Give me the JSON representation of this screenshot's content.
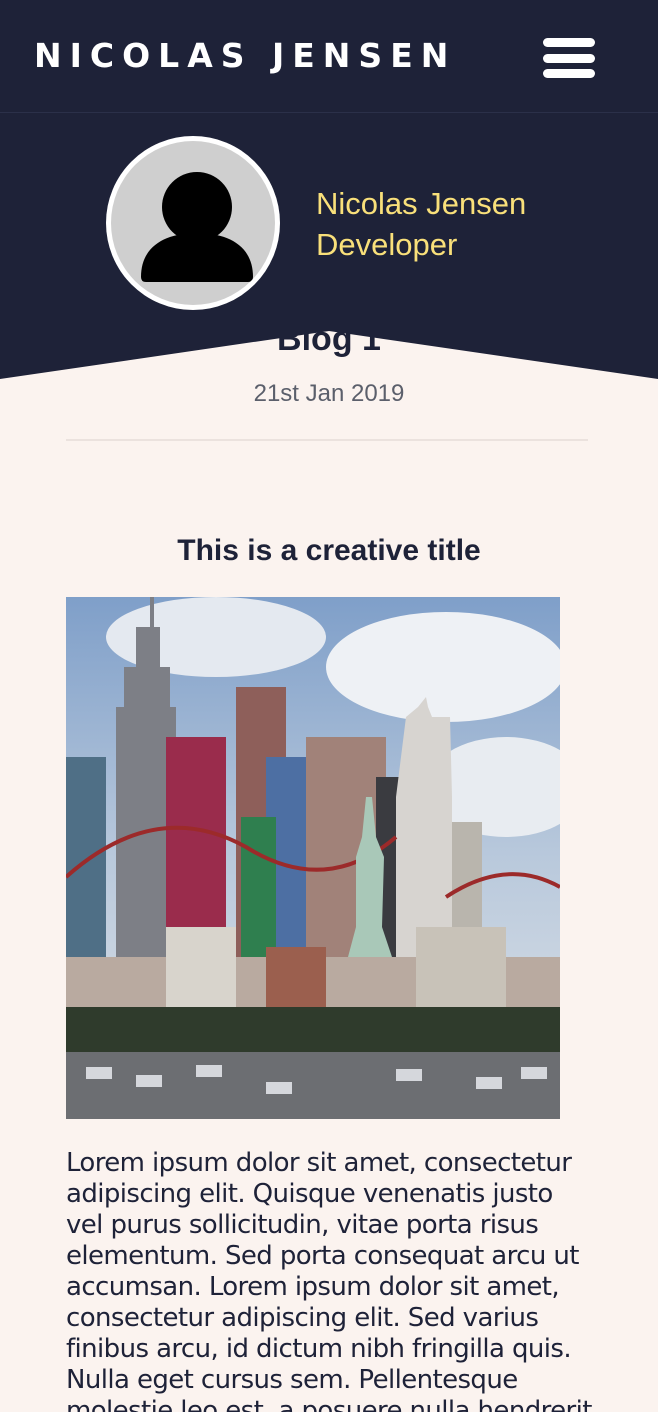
{
  "header": {
    "brand": "NICOLAS JENSEN",
    "menu_icon": "hamburger-menu-icon"
  },
  "profile": {
    "name": "Nicolas Jensen",
    "role": "Developer",
    "avatar_icon": "user-silhouette-icon",
    "accent_color": "#f9e07a",
    "band_color": "#1e2238"
  },
  "post": {
    "blog_heading": "Blog 1",
    "date": "21st Jan 2019",
    "title": "This is a creative title",
    "image_alt": "city-skyline-photo",
    "body": "Lorem ipsum dolor sit amet, consectetur adipiscing elit. Quisque venenatis justo vel purus sollicitudin, vitae porta risus elementum. Sed porta consequat arcu ut accumsan. Lorem ipsum dolor sit amet, consectetur adipiscing elit. Sed varius finibus arcu, id dictum nibh fringilla quis. Nulla eget cursus sem. Pellentesque molestie leo est, a posuere nulla hendrerit"
  },
  "colors": {
    "page_background": "#fbf3ef",
    "text_dark": "#1e2238",
    "muted": "#5b5f6b"
  }
}
